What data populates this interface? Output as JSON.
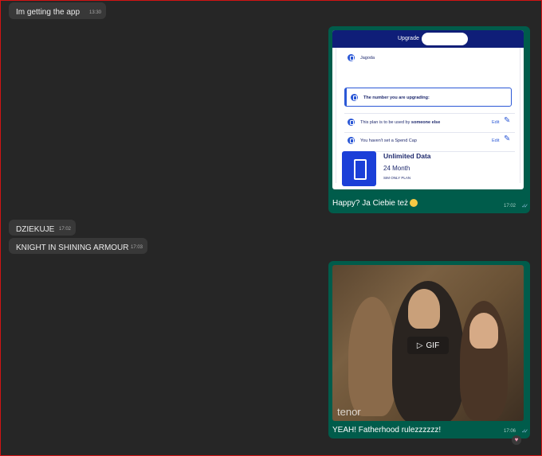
{
  "messages": {
    "m1": {
      "text": "Im getting the app",
      "time": "13:30"
    },
    "m2": {
      "caption": "Happy? Ja Ciebie też",
      "time": "17:02",
      "screenshot": {
        "header": "Upgrade",
        "name": "Jagoda",
        "upgrading": "The number you are upgrading:",
        "plan_used_prefix": "This plan is to be used by",
        "plan_used_bold": "someone else",
        "spend_cap": "You haven't set a Spend Cap",
        "edit": "Edit",
        "plan_title": "Unlimited Data",
        "plan_term": "24 Month",
        "plan_type": "SIM ONLY PLAN"
      }
    },
    "m3": {
      "text": "DZIEKUJE",
      "time": "17:02"
    },
    "m4": {
      "text": "KNIGHT IN SHINING ARMOUR",
      "time": "17:03"
    },
    "m5": {
      "caption": "YEAH! Fatherhood rulezzzzzz!",
      "time": "17:06",
      "gif_label": "GIF",
      "gif_brand": "tenor",
      "reaction": "♥"
    }
  },
  "colors": {
    "incoming": "#383838",
    "outgoing": "#005c4b",
    "background": "#262626"
  }
}
